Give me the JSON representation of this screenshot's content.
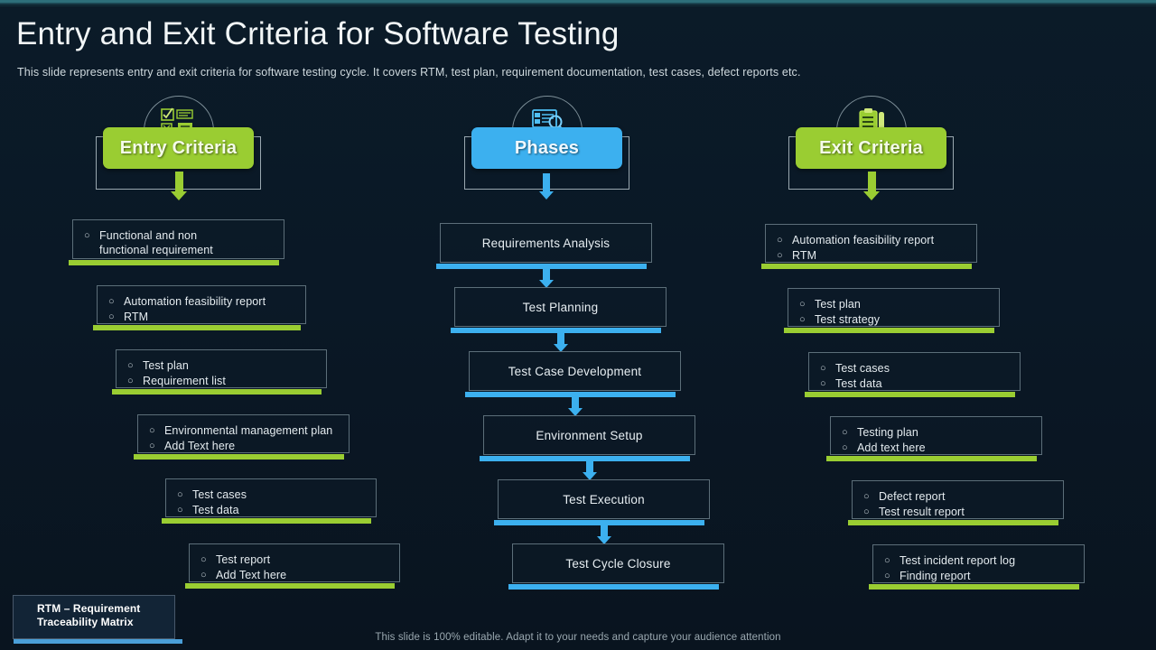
{
  "header": {
    "title": "Entry and Exit Criteria for Software Testing",
    "subtitle": "This slide represents entry and exit criteria for software testing cycle. It covers RTM, test plan, requirement documentation, test cases, defect reports etc."
  },
  "colors": {
    "green": "#9acd32",
    "blue": "#3cb0ef",
    "background": "#0a1a26",
    "box_border": "#5c6e79",
    "text": "#e4ebef"
  },
  "columns": [
    {
      "key": "entry",
      "title": "Entry Criteria",
      "accent": "#9acd32",
      "icon": "checklist-document-icon",
      "items": [
        {
          "lines": [
            "Functional and non",
            "functional requirement"
          ],
          "single_bullet": true
        },
        {
          "lines": [
            "Automation feasibility report",
            "RTM"
          ],
          "single_bullet": false
        },
        {
          "lines": [
            "Test plan",
            "Requirement list"
          ],
          "single_bullet": false
        },
        {
          "lines": [
            "Environmental management plan",
            "Add Text here"
          ],
          "single_bullet": false
        },
        {
          "lines": [
            "Test cases",
            "Test data"
          ],
          "single_bullet": false
        },
        {
          "lines": [
            "Test report",
            "Add Text here"
          ],
          "single_bullet": false
        }
      ]
    },
    {
      "key": "phases",
      "title": "Phases",
      "accent": "#3cb0ef",
      "icon": "monitor-magnifier-icon",
      "steps": [
        "Requirements Analysis",
        "Test Planning",
        "Test Case Development",
        "Environment Setup",
        "Test Execution",
        "Test Cycle Closure"
      ]
    },
    {
      "key": "exit",
      "title": "Exit Criteria",
      "accent": "#9acd32",
      "icon": "clipboard-pen-icon",
      "items": [
        {
          "lines": [
            "Automation feasibility report",
            "RTM"
          ],
          "single_bullet": false
        },
        {
          "lines": [
            "Test plan",
            "Test strategy"
          ],
          "single_bullet": false
        },
        {
          "lines": [
            "Test cases",
            "Test data"
          ],
          "single_bullet": false
        },
        {
          "lines": [
            "Testing plan",
            "Add text here"
          ],
          "single_bullet": false
        },
        {
          "lines": [
            "Defect report",
            "Test result report"
          ],
          "single_bullet": false
        },
        {
          "lines": [
            "Test incident report log",
            "Finding report"
          ],
          "single_bullet": false
        }
      ]
    }
  ],
  "legend": {
    "line1": "RTM – Requirement",
    "line2": "Traceability Matrix"
  },
  "footer": "This slide is 100% editable. Adapt it to your  needs and capture your audience attention",
  "bullet_glyph": "○"
}
